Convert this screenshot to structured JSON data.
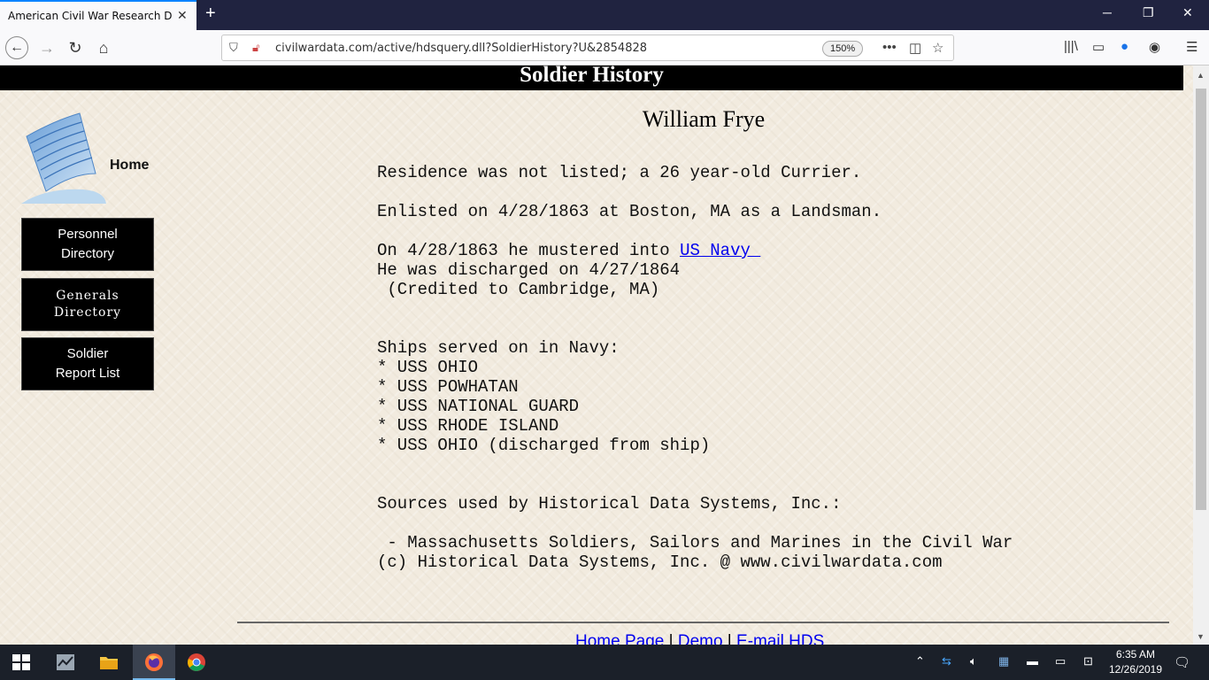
{
  "browser": {
    "tab_title": "American Civil War Research Datab",
    "tab_close": "✕",
    "new_tab": "+",
    "url": "civilwardata.com/active/hdsquery.dll?SoldierHistory?U&2854828",
    "zoom": "150%"
  },
  "page": {
    "header_title": "Soldier History",
    "sidebar": {
      "home_label": "Home",
      "buttons": [
        {
          "line1": "Personnel",
          "line2": "Directory"
        },
        {
          "line1": "Generals",
          "line2": "Directory"
        },
        {
          "line1": "Soldier",
          "line2": "Report List"
        }
      ]
    },
    "soldier_name": "William Frye",
    "residence_line": "Residence was not listed; a 26 year-old Currier.",
    "enlisted_line": "Enlisted on 4/28/1863 at Boston, MA as a Landsman.",
    "mustered_prefix": "On 4/28/1863 he mustered into ",
    "mustered_link": "US Navy ",
    "discharged_line": "He was discharged on 4/27/1864",
    "credited_line": " (Credited to Cambridge, MA)",
    "ships_heading": "Ships served on in Navy:",
    "ships": [
      "* USS OHIO",
      "* USS POWHATAN",
      "* USS NATIONAL GUARD",
      "* USS RHODE ISLAND",
      "* USS OHIO (discharged from ship)"
    ],
    "sources_heading": "Sources used by Historical Data Systems, Inc.:",
    "source_item": " - Massachusetts Soldiers, Sailors and Marines in the Civil War",
    "copyright": "(c) Historical Data Systems, Inc. @ www.civilwardata.com",
    "footer": {
      "home_page": "Home Page",
      "sep": " | ",
      "demo": "Demo",
      "email": "E-mail HDS"
    }
  },
  "taskbar": {
    "time": "6:35 AM",
    "date": "12/26/2019"
  }
}
